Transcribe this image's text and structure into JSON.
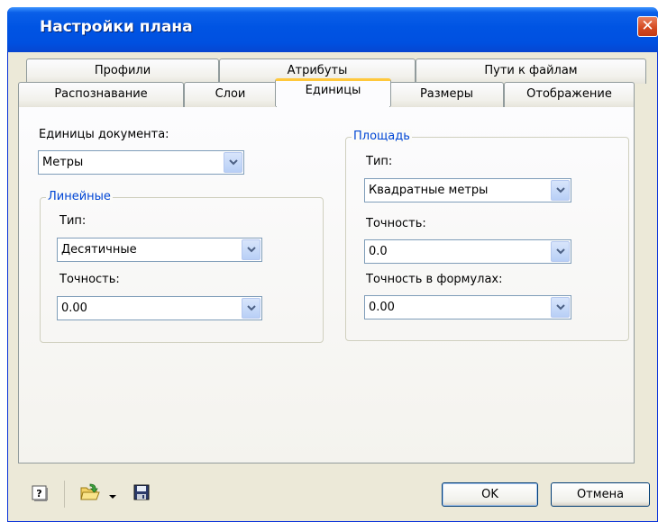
{
  "window": {
    "title": "Настройки плана",
    "close_glyph": "✕"
  },
  "tabs_back": [
    {
      "label": "Профили"
    },
    {
      "label": "Атрибуты"
    },
    {
      "label": "Пути к файлам"
    }
  ],
  "tabs_front": [
    {
      "label": "Распознавание"
    },
    {
      "label": "Слои"
    },
    {
      "label": "Единицы",
      "active": true
    },
    {
      "label": "Размеры"
    },
    {
      "label": "Отображение"
    }
  ],
  "units": {
    "doc_units_label": "Единицы документа:",
    "doc_units_value": "Метры",
    "linear": {
      "title": "Линейные",
      "type_label": "Тип:",
      "type_value": "Десятичные",
      "precision_label": "Точность:",
      "precision_value": "0.00"
    },
    "area": {
      "title": "Площадь",
      "type_label": "Тип:",
      "type_value": "Квадратные метры",
      "precision_label": "Точность:",
      "precision_value": "0.0",
      "formula_precision_label": "Точность в формулах:",
      "formula_precision_value": "0.00"
    }
  },
  "footer": {
    "ok_label": "OK",
    "cancel_label": "Отмена",
    "icons": [
      "help-icon",
      "open-folder-icon",
      "dropdown-arrow-icon",
      "save-icon"
    ]
  },
  "colors": {
    "title_bar": "#0054e3",
    "group_title": "#0046d5",
    "active_tab_accent": "#ffc83c",
    "close_button": "#d3481f"
  }
}
